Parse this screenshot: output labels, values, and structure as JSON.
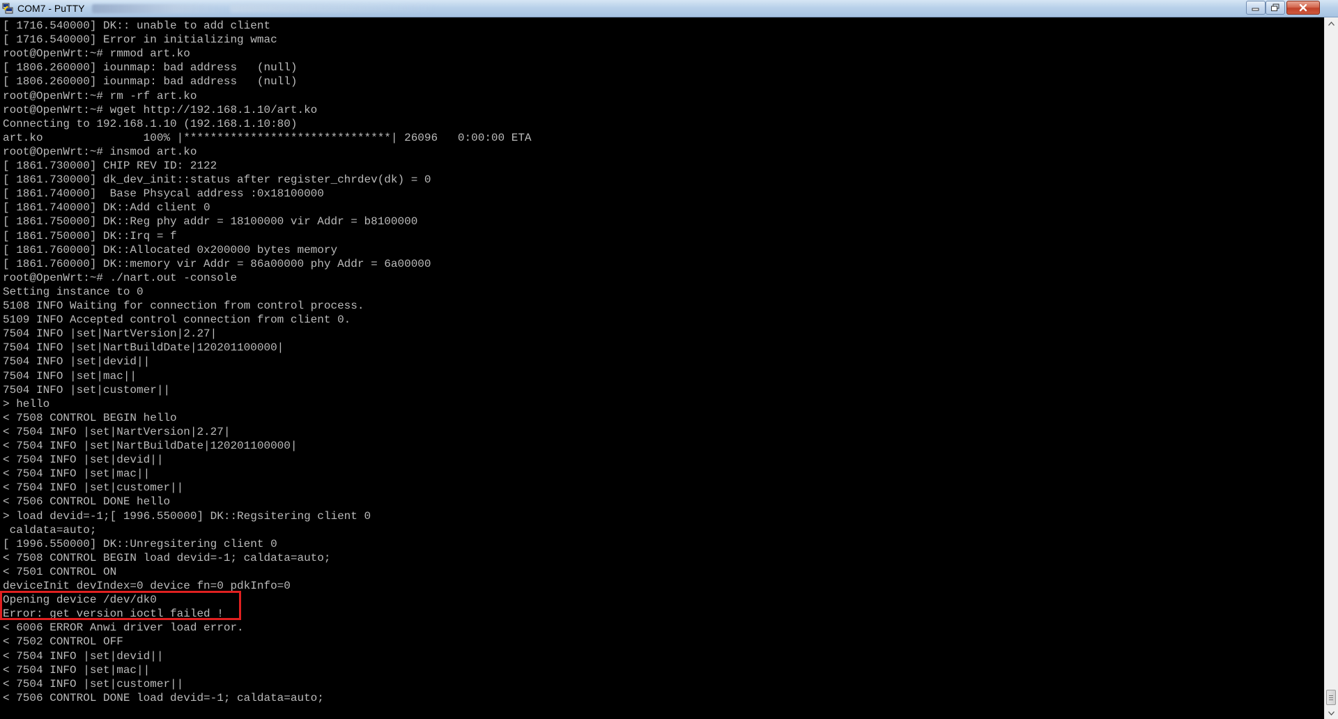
{
  "window": {
    "title": "COM7 - PuTTY",
    "icon": "putty-icon",
    "controls": {
      "minimize_icon": "minimize-icon",
      "maximize_icon": "maximize-icon",
      "close_icon": "close-icon"
    }
  },
  "colors": {
    "terminal_background": "#000000",
    "terminal_text": "#bbbbbb",
    "cursor": "#00ff00",
    "highlight_border": "#e02020",
    "close_button": "#c0422a"
  },
  "terminal": {
    "lines": [
      "[ 1716.540000] DK:: unable to add client",
      "[ 1716.540000] Error in initializing wmac",
      "root@OpenWrt:~# rmmod art.ko",
      "[ 1806.260000] iounmap: bad address   (null)",
      "[ 1806.260000] iounmap: bad address   (null)",
      "root@OpenWrt:~# rm -rf art.ko",
      "root@OpenWrt:~# wget http://192.168.1.10/art.ko",
      "Connecting to 192.168.1.10 (192.168.1.10:80)",
      "art.ko               100% |*******************************| 26096   0:00:00 ETA",
      "root@OpenWrt:~# insmod art.ko",
      "[ 1861.730000] CHIP REV ID: 2122",
      "[ 1861.730000] dk_dev_init::status after register_chrdev(dk) = 0",
      "[ 1861.740000]  Base Phsycal address :0x18100000",
      "[ 1861.740000] DK::Add client 0",
      "[ 1861.750000] DK::Reg phy addr = 18100000 vir Addr = b8100000",
      "[ 1861.750000] DK::Irq = f",
      "[ 1861.760000] DK::Allocated 0x200000 bytes memory",
      "[ 1861.760000] DK::memory vir Addr = 86a00000 phy Addr = 6a00000",
      "root@OpenWrt:~# ./nart.out -console",
      "Setting instance to 0",
      "5108 INFO Waiting for connection from control process.",
      "5109 INFO Accepted control connection from client 0.",
      "7504 INFO |set|NartVersion|2.27|",
      "7504 INFO |set|NartBuildDate|120201100000|",
      "7504 INFO |set|devid||",
      "7504 INFO |set|mac||",
      "7504 INFO |set|customer||",
      "> hello",
      "< 7508 CONTROL BEGIN hello",
      "< 7504 INFO |set|NartVersion|2.27|",
      "< 7504 INFO |set|NartBuildDate|120201100000|",
      "< 7504 INFO |set|devid||",
      "< 7504 INFO |set|mac||",
      "< 7504 INFO |set|customer||",
      "< 7506 CONTROL DONE hello",
      "> load devid=-1;[ 1996.550000] DK::Regsitering client 0",
      " caldata=auto;",
      "[ 1996.550000] DK::Unregsitering client 0",
      "< 7508 CONTROL BEGIN load devid=-1; caldata=auto;",
      "< 7501 CONTROL ON",
      "deviceInit devIndex=0 device fn=0 pdkInfo=0",
      "Opening device /dev/dk0",
      "Error: get version ioctl failed !",
      "< 6006 ERROR Anwi driver load error.",
      "< 7502 CONTROL OFF",
      "< 7504 INFO |set|devid||",
      "< 7504 INFO |set|mac||",
      "< 7504 INFO |set|customer||",
      "< 7506 CONTROL DONE load devid=-1; caldata=auto;"
    ]
  },
  "scrollbar": {
    "up_icon": "scroll-up-arrow-icon",
    "down_icon": "scroll-down-arrow-icon",
    "position": "bottom"
  }
}
